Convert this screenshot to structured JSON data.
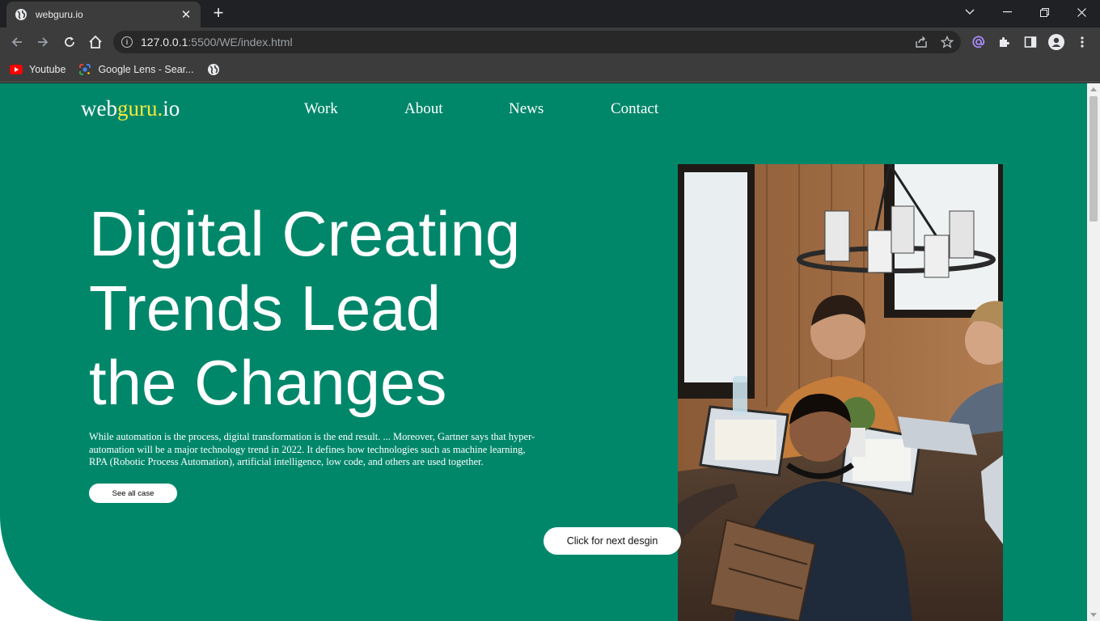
{
  "browser": {
    "tab_title": "webguru.io",
    "tab_close": "✕",
    "new_tab": "+",
    "url_host": "127.0.0.1",
    "url_path": ":5500/WE/index.html",
    "bookmarks": [
      {
        "label": "Youtube",
        "icon": "youtube-icon"
      },
      {
        "label": "Google Lens - Sear...",
        "icon": "google-lens-icon"
      }
    ],
    "window_controls": [
      "chevron-down-icon",
      "minimize-icon",
      "restore-icon",
      "close-icon"
    ]
  },
  "site": {
    "logo_main": "web",
    "logo_highlight": "guru.",
    "logo_tail": "io",
    "nav": [
      "Work",
      "About",
      "News",
      "Contact"
    ],
    "headline": [
      "Digital Creating",
      "Trends Lead",
      "the Changes"
    ],
    "lead": "While automation is the process, digital transformation is the end result. ... Moreover, Gartner says that hyper-automation will be a major technology trend in 2022. It defines how technologies such as machine learning, RPA (Robotic Process Automation), artificial intelligence, low code, and others are used together.",
    "cta_label": "See all case",
    "next_label": "Click for next desgin"
  },
  "colors": {
    "brand_green": "#00876a",
    "logo_accent": "#f7e83a"
  }
}
